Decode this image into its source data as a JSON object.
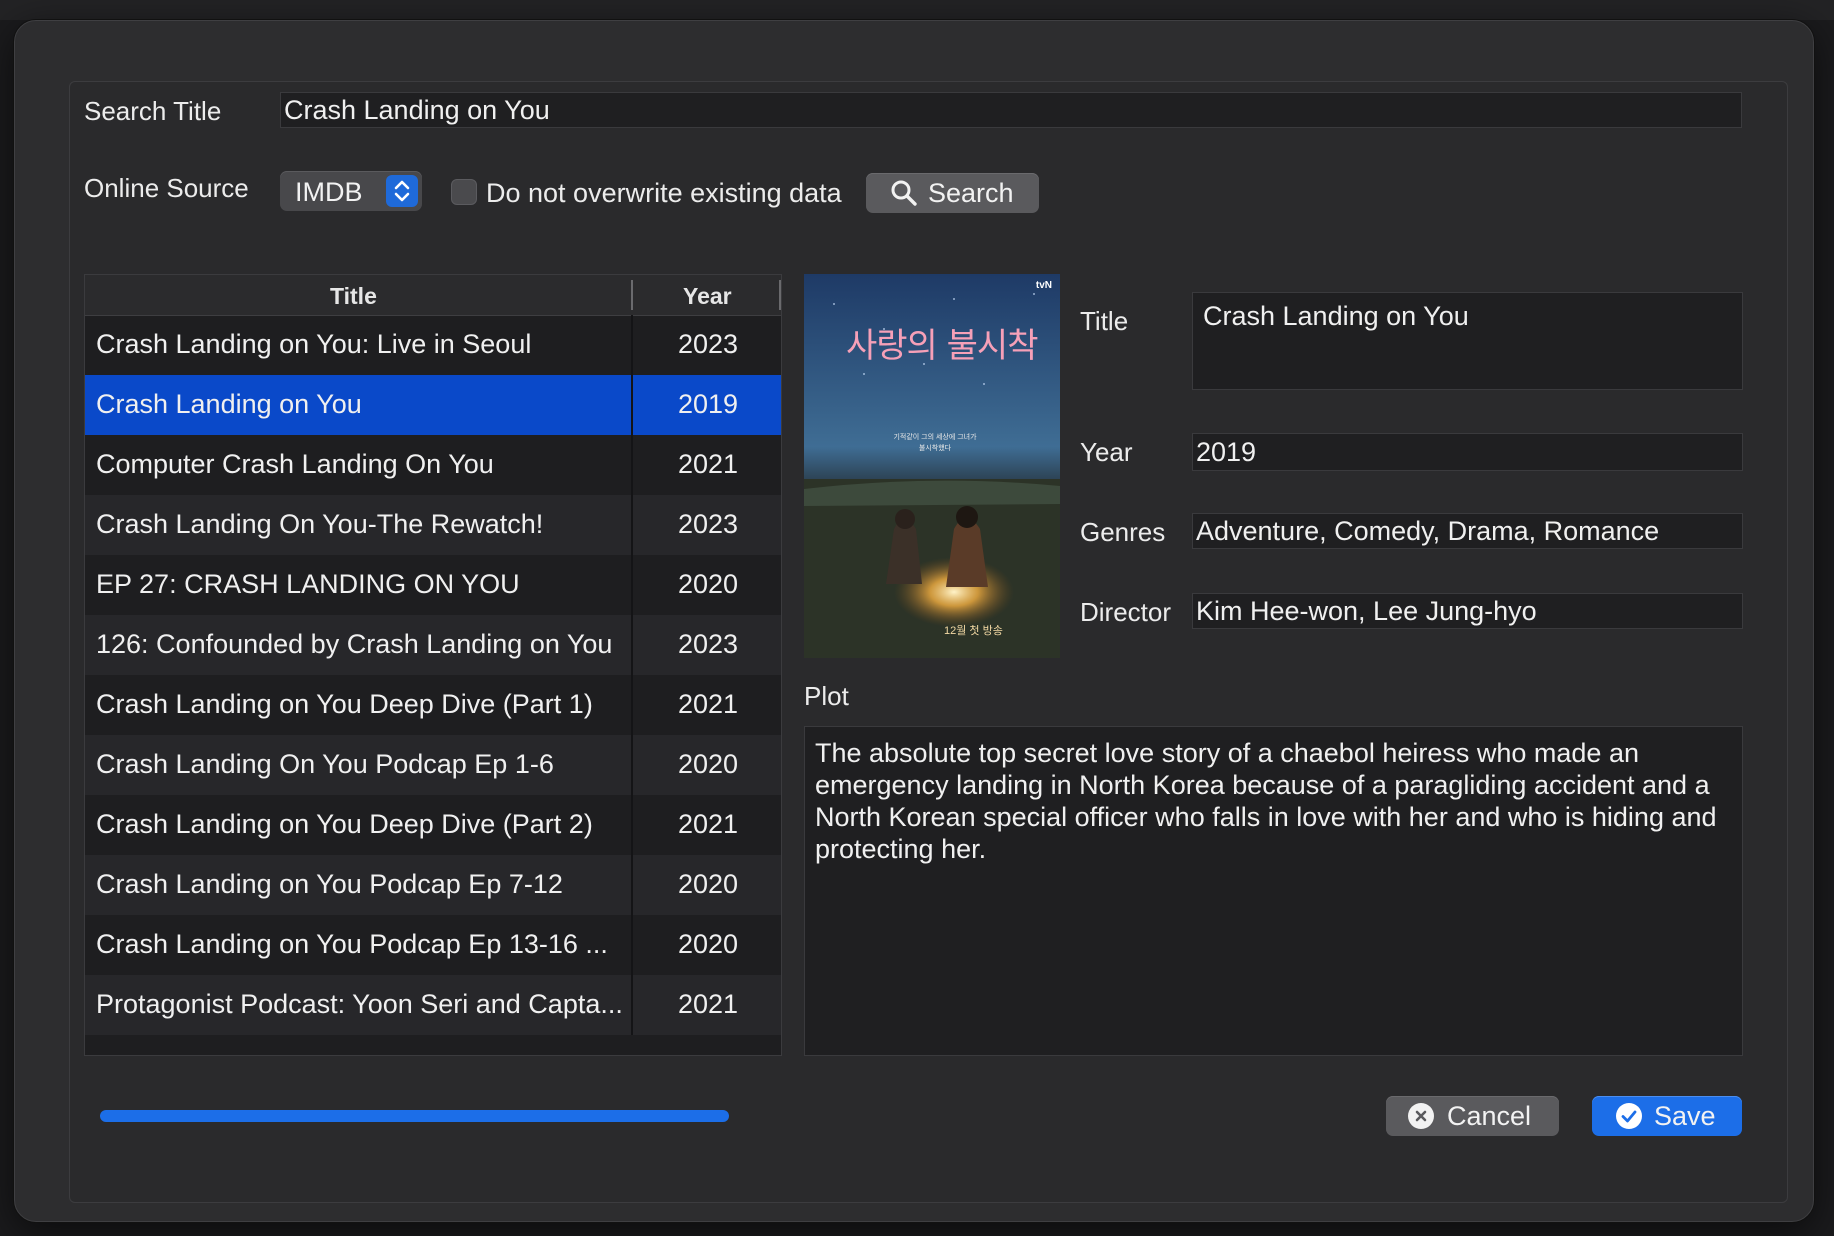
{
  "form": {
    "search_title_label": "Search Title",
    "search_title_value": "Crash Landing on You",
    "online_source_label": "Online Source",
    "online_source_value": "IMDB",
    "no_overwrite_label": "Do not overwrite existing data",
    "no_overwrite_checked": false,
    "search_button": "Search"
  },
  "results": {
    "columns": [
      "Title",
      "Year"
    ],
    "rows": [
      {
        "title": "Crash Landing on You: Live in Seoul",
        "year": "2023"
      },
      {
        "title": "Crash Landing on You",
        "year": "2019",
        "selected": true
      },
      {
        "title": "Computer Crash Landing On You",
        "year": "2021"
      },
      {
        "title": "Crash Landing On You-The Rewatch!",
        "year": "2023"
      },
      {
        "title": "EP 27: CRASH LANDING ON YOU",
        "year": "2020"
      },
      {
        "title": "126: Confounded by Crash Landing on You",
        "year": "2023"
      },
      {
        "title": "Crash Landing on You Deep Dive (Part 1)",
        "year": "2021"
      },
      {
        "title": "Crash Landing On You Podcap Ep 1-6",
        "year": "2020"
      },
      {
        "title": "Crash Landing on You Deep Dive (Part 2)",
        "year": "2021"
      },
      {
        "title": "Crash Landing on You Podcap Ep 7-12",
        "year": "2020"
      },
      {
        "title": "Crash Landing on You Podcap Ep 13-16 ...",
        "year": "2020"
      },
      {
        "title": "Protagonist Podcast: Yoon Seri and Capta...",
        "year": "2021"
      }
    ]
  },
  "details": {
    "title_label": "Title",
    "title_value": "Crash Landing on You",
    "year_label": "Year",
    "year_value": "2019",
    "genres_label": "Genres",
    "genres_value": "Adventure, Comedy, Drama, Romance",
    "director_label": "Director",
    "director_value": "Kim Hee-won, Lee Jung-hyo",
    "plot_label": "Plot",
    "plot_value": "The absolute top secret love story of a chaebol heiress who made an emergency landing in North Korea because of a paragliding accident and a North Korean special officer who falls in love with her and who is hiding and protecting her."
  },
  "poster": {
    "title_text": "사랑의 불시착",
    "network": "tvN",
    "tagline": "기적같이 그의 세상에 그녀가 불시착했다",
    "airdate_text": "12월 첫 방송"
  },
  "progress": {
    "value": 1.0
  },
  "footer": {
    "cancel_button": "Cancel",
    "save_button": "Save"
  },
  "colors": {
    "accent": "#0a49c9",
    "button_blue": "#1c6ee8",
    "background": "#2d2d2f"
  },
  "icons": {
    "search": "magnifier-icon",
    "cancel": "x-circle-icon",
    "save": "checkmark-circle-icon",
    "select": "chevron-updown-icon"
  }
}
